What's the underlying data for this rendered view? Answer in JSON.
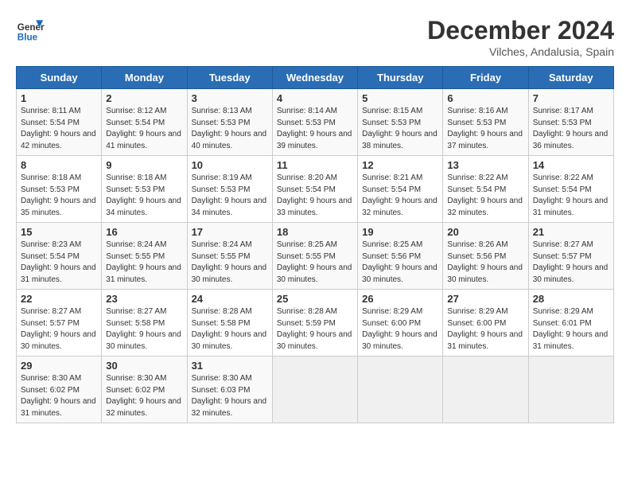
{
  "header": {
    "logo_line1": "General",
    "logo_line2": "Blue",
    "month": "December 2024",
    "location": "Vilches, Andalusia, Spain"
  },
  "weekdays": [
    "Sunday",
    "Monday",
    "Tuesday",
    "Wednesday",
    "Thursday",
    "Friday",
    "Saturday"
  ],
  "weeks": [
    [
      {
        "day": "1",
        "sunrise": "8:11 AM",
        "sunset": "5:54 PM",
        "daylight": "9 hours and 42 minutes."
      },
      {
        "day": "2",
        "sunrise": "8:12 AM",
        "sunset": "5:54 PM",
        "daylight": "9 hours and 41 minutes."
      },
      {
        "day": "3",
        "sunrise": "8:13 AM",
        "sunset": "5:53 PM",
        "daylight": "9 hours and 40 minutes."
      },
      {
        "day": "4",
        "sunrise": "8:14 AM",
        "sunset": "5:53 PM",
        "daylight": "9 hours and 39 minutes."
      },
      {
        "day": "5",
        "sunrise": "8:15 AM",
        "sunset": "5:53 PM",
        "daylight": "9 hours and 38 minutes."
      },
      {
        "day": "6",
        "sunrise": "8:16 AM",
        "sunset": "5:53 PM",
        "daylight": "9 hours and 37 minutes."
      },
      {
        "day": "7",
        "sunrise": "8:17 AM",
        "sunset": "5:53 PM",
        "daylight": "9 hours and 36 minutes."
      }
    ],
    [
      {
        "day": "8",
        "sunrise": "8:18 AM",
        "sunset": "5:53 PM",
        "daylight": "9 hours and 35 minutes."
      },
      {
        "day": "9",
        "sunrise": "8:18 AM",
        "sunset": "5:53 PM",
        "daylight": "9 hours and 34 minutes."
      },
      {
        "day": "10",
        "sunrise": "8:19 AM",
        "sunset": "5:53 PM",
        "daylight": "9 hours and 34 minutes."
      },
      {
        "day": "11",
        "sunrise": "8:20 AM",
        "sunset": "5:54 PM",
        "daylight": "9 hours and 33 minutes."
      },
      {
        "day": "12",
        "sunrise": "8:21 AM",
        "sunset": "5:54 PM",
        "daylight": "9 hours and 32 minutes."
      },
      {
        "day": "13",
        "sunrise": "8:22 AM",
        "sunset": "5:54 PM",
        "daylight": "9 hours and 32 minutes."
      },
      {
        "day": "14",
        "sunrise": "8:22 AM",
        "sunset": "5:54 PM",
        "daylight": "9 hours and 31 minutes."
      }
    ],
    [
      {
        "day": "15",
        "sunrise": "8:23 AM",
        "sunset": "5:54 PM",
        "daylight": "9 hours and 31 minutes."
      },
      {
        "day": "16",
        "sunrise": "8:24 AM",
        "sunset": "5:55 PM",
        "daylight": "9 hours and 31 minutes."
      },
      {
        "day": "17",
        "sunrise": "8:24 AM",
        "sunset": "5:55 PM",
        "daylight": "9 hours and 30 minutes."
      },
      {
        "day": "18",
        "sunrise": "8:25 AM",
        "sunset": "5:55 PM",
        "daylight": "9 hours and 30 minutes."
      },
      {
        "day": "19",
        "sunrise": "8:25 AM",
        "sunset": "5:56 PM",
        "daylight": "9 hours and 30 minutes."
      },
      {
        "day": "20",
        "sunrise": "8:26 AM",
        "sunset": "5:56 PM",
        "daylight": "9 hours and 30 minutes."
      },
      {
        "day": "21",
        "sunrise": "8:27 AM",
        "sunset": "5:57 PM",
        "daylight": "9 hours and 30 minutes."
      }
    ],
    [
      {
        "day": "22",
        "sunrise": "8:27 AM",
        "sunset": "5:57 PM",
        "daylight": "9 hours and 30 minutes."
      },
      {
        "day": "23",
        "sunrise": "8:27 AM",
        "sunset": "5:58 PM",
        "daylight": "9 hours and 30 minutes."
      },
      {
        "day": "24",
        "sunrise": "8:28 AM",
        "sunset": "5:58 PM",
        "daylight": "9 hours and 30 minutes."
      },
      {
        "day": "25",
        "sunrise": "8:28 AM",
        "sunset": "5:59 PM",
        "daylight": "9 hours and 30 minutes."
      },
      {
        "day": "26",
        "sunrise": "8:29 AM",
        "sunset": "6:00 PM",
        "daylight": "9 hours and 30 minutes."
      },
      {
        "day": "27",
        "sunrise": "8:29 AM",
        "sunset": "6:00 PM",
        "daylight": "9 hours and 31 minutes."
      },
      {
        "day": "28",
        "sunrise": "8:29 AM",
        "sunset": "6:01 PM",
        "daylight": "9 hours and 31 minutes."
      }
    ],
    [
      {
        "day": "29",
        "sunrise": "8:30 AM",
        "sunset": "6:02 PM",
        "daylight": "9 hours and 31 minutes."
      },
      {
        "day": "30",
        "sunrise": "8:30 AM",
        "sunset": "6:02 PM",
        "daylight": "9 hours and 32 minutes."
      },
      {
        "day": "31",
        "sunrise": "8:30 AM",
        "sunset": "6:03 PM",
        "daylight": "9 hours and 32 minutes."
      },
      null,
      null,
      null,
      null
    ]
  ]
}
